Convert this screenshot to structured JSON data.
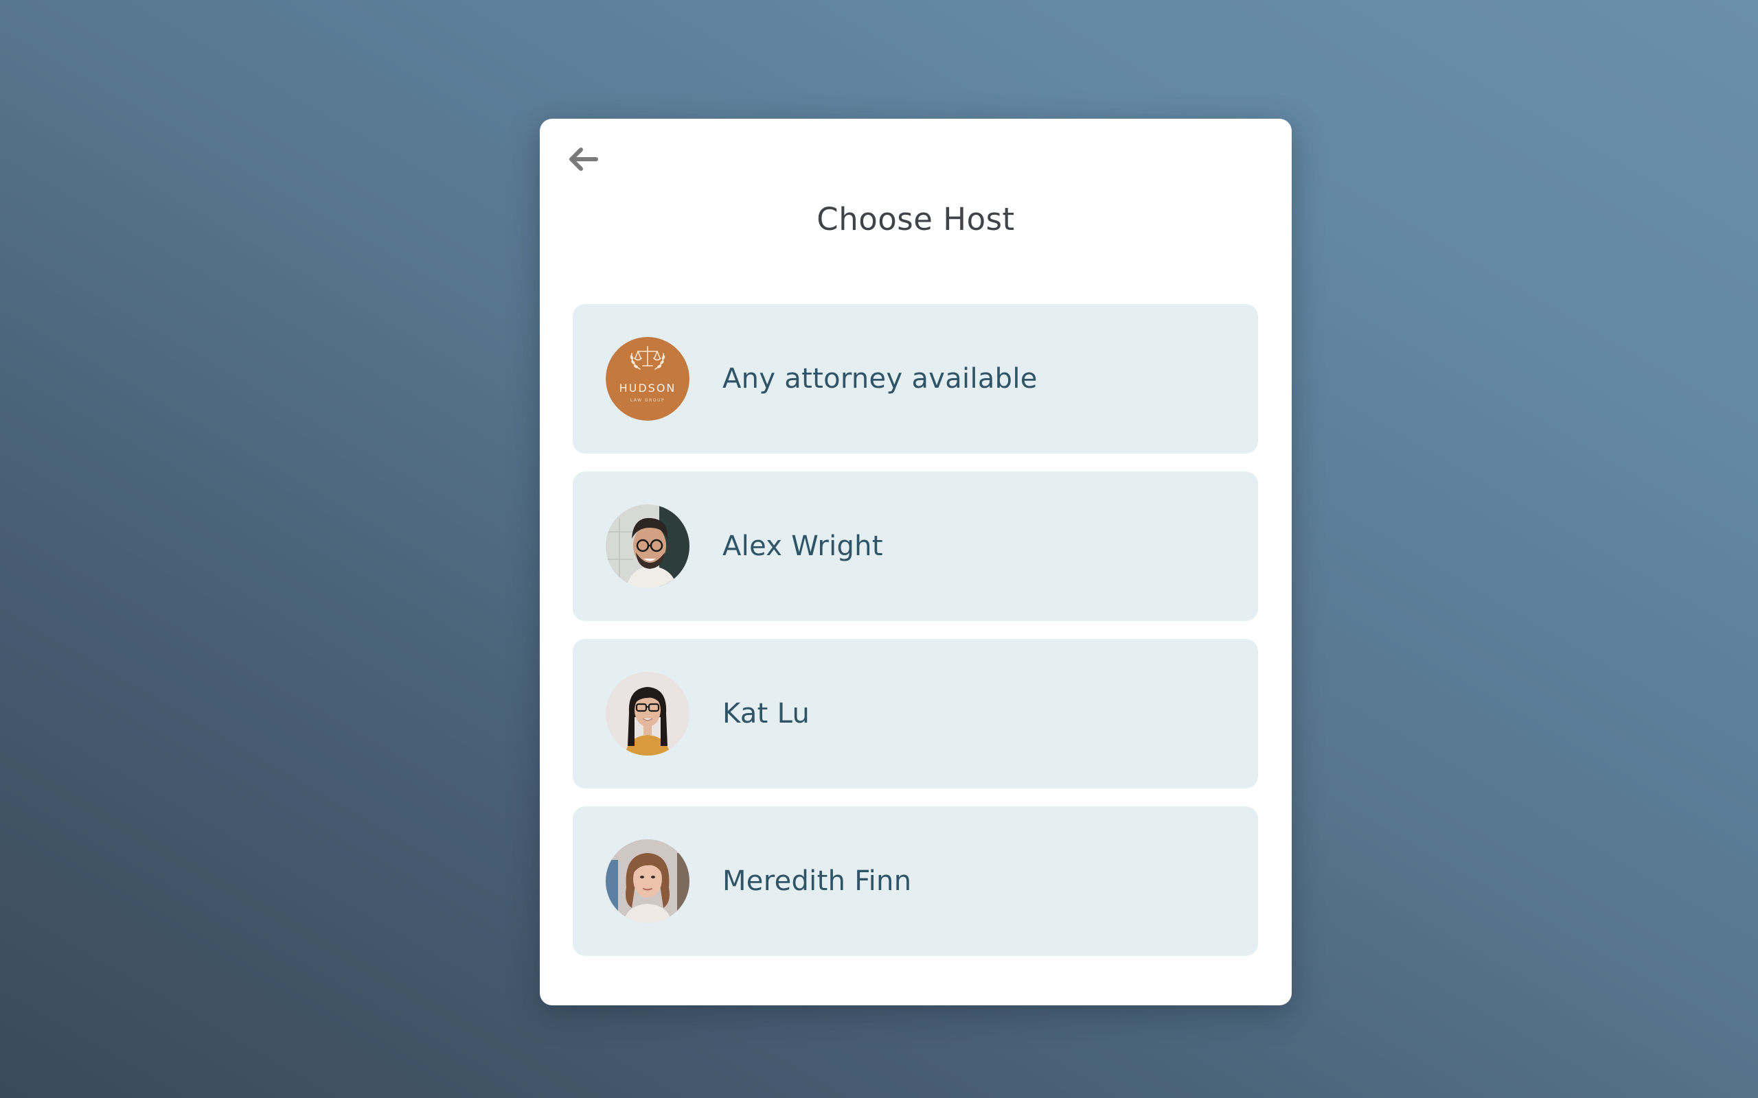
{
  "dialog": {
    "title": "Choose Host",
    "back_icon": "arrow-left-icon"
  },
  "hosts": [
    {
      "name": "Any attorney available",
      "avatar": "firm-logo",
      "logo_text": "HUDSON",
      "logo_subtext": "LAW GROUP"
    },
    {
      "name": "Alex Wright",
      "avatar": "person-photo"
    },
    {
      "name": "Kat Lu",
      "avatar": "person-photo"
    },
    {
      "name": "Meredith Finn",
      "avatar": "person-photo"
    }
  ],
  "colors": {
    "card_bg": "#ffffff",
    "row_bg": "#e5eef1",
    "name_text": "#2f5468",
    "title_text": "#404448",
    "logo_bg": "#c47a3e"
  }
}
